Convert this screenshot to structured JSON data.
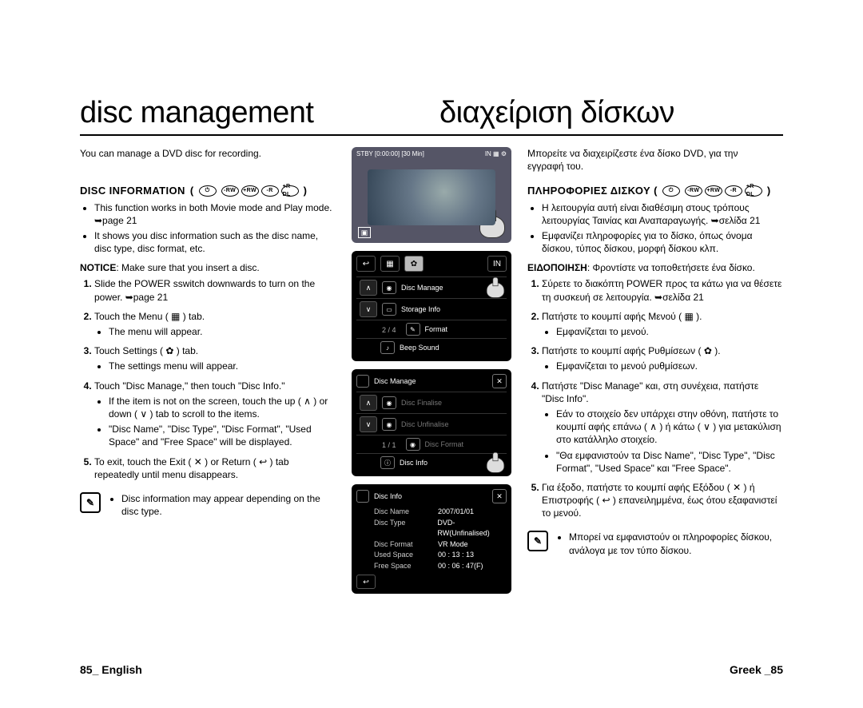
{
  "titles": {
    "left": "disc management",
    "right": "διαχείριση δίσκων"
  },
  "intro": {
    "left": "You can manage a DVD disc for recording.",
    "right": "Μπορείτε να διαχειρίζεστε ένα δίσκο DVD, για την εγγραφή του."
  },
  "sectionHead": {
    "left": "DISC INFORMATION",
    "right": "ΠΛΗΡΟΦΟΡΙΕΣ ΔΙΣΚΟΥ (",
    "symbols": [
      "-RW",
      "+RW",
      "-R",
      "+R DL"
    ]
  },
  "eng": {
    "b1": "This function works in both Movie mode and Play mode. ➥page 21",
    "b2": "It shows you disc information such as the disc name, disc type, disc format, etc.",
    "notice": "NOTICE: Make sure that you insert a disc.",
    "s1": "Slide the POWER sswitch downwards to turn on the power. ➥page 21",
    "s2": "Touch the Menu ( ▦ ) tab.",
    "s2a": "The menu will appear.",
    "s3": "Touch Settings ( ✿ ) tab.",
    "s3a": "The settings menu will appear.",
    "s4": "Touch \"Disc Manage,\" then touch \"Disc Info.\"",
    "s4a": "If the item is not on the screen, touch the up ( ∧ ) or down ( ∨ ) tab to scroll to the items.",
    "s4b": "\"Disc Name\", \"Disc Type\", \"Disc Format\", \"Used Space\" and \"Free Space\" will be displayed.",
    "s5": "To exit, touch the Exit ( ✕ ) or Return ( ↩ ) tab repeatedly until menu disappears.",
    "note": "Disc information may appear depending on the disc type."
  },
  "grk": {
    "b1": "Η λειτουργία αυτή είναι διαθέσιμη στους τρόπους λειτουργίας Ταινίας και Αναπαραγωγής. ➥σελίδα 21",
    "b2": "Εμφανίζει πληροφορίες για το δίσκο, όπως όνομα δίσκου, τύπος δίσκου, μορφή δίσκου κλπ.",
    "notice": "ΕΙΔΟΠΟΙΗΣΗ: Φροντίστε να τοποθετήσετε ένα δίσκο.",
    "s1": "Σύρετε το διακόπτη POWER προς τα κάτω για να θέσετε τη συσκευή σε λειτουργία. ➥σελίδα 21",
    "s2": "Πατήστε το κουμπί αφής Μενού ( ▦ ).",
    "s2a": "Εμφανίζεται το μενού.",
    "s3": "Πατήστε το κουμπί αφής Ρυθμίσεων ( ✿ ).",
    "s3a": "Εμφανίζεται το μενού ρυθμίσεων.",
    "s4": "Πατήστε \"Disc Manage\" και, στη συνέχεια, πατήστε \"Disc Info\".",
    "s4a": "Εάν το στοιχείο δεν υπάρχει στην οθόνη, πατήστε το κουμπί αφής επάνω ( ∧ ) ή κάτω ( ∨ ) για μετακύλιση στο κατάλληλο στοιχείο.",
    "s4b": "\"Θα εμφανιστούν τα Disc Name\", \"Disc Type\", \"Disc Format\", \"Used Space\" και \"Free Space\".",
    "s5": "Για έξοδο, πατήστε το κουμπί αφής Εξόδου ( ✕ ) ή Επιστροφής ( ↩ ) επανειλημμένα, έως ότου εξαφανιστεί το μενού.",
    "note": "Μπορεί να εμφανιστούν οι πληροφορίες δίσκου, ανάλογα με τον τύπο δίσκου."
  },
  "screens": {
    "rec": {
      "status": "STBY  [0:00:00] [30 Min]",
      "tags": "IN  ▦  ⚙"
    },
    "settings": {
      "pager": "2 / 4",
      "items": [
        "Disc Manage",
        "Storage Info",
        "Format",
        "Beep Sound"
      ]
    },
    "discManage": {
      "title": "Disc Manage",
      "pager": "1 / 1",
      "items": [
        "Disc Finalise",
        "Disc Unfinalise",
        "Disc Format",
        "Disc Info"
      ]
    },
    "discInfo": {
      "title": "Disc Info",
      "rows": [
        {
          "k": "Disc Name",
          "v": "2007/01/01"
        },
        {
          "k": "Disc Type",
          "v": "DVD-RW(Unfinalised)"
        },
        {
          "k": "Disc Format",
          "v": "VR Mode"
        },
        {
          "k": "Used Space",
          "v": "00 : 13 : 13"
        },
        {
          "k": "Free Space",
          "v": "00 : 06 : 47(F)"
        }
      ]
    }
  },
  "footer": {
    "left": "85_ English",
    "right": "Greek _85"
  }
}
